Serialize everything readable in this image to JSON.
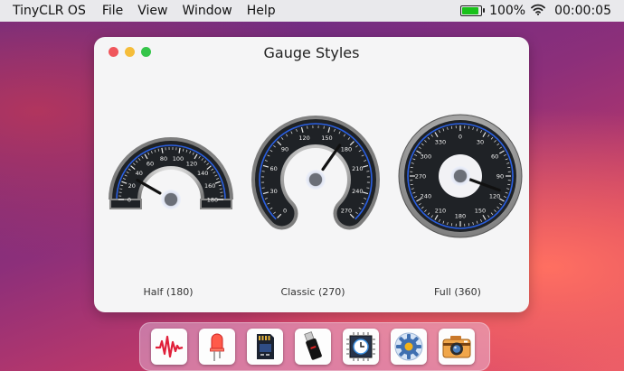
{
  "menubar": {
    "app_name": "TinyCLR OS",
    "menus": [
      "File",
      "View",
      "Window",
      "Help"
    ],
    "battery_percent": "100%",
    "battery_level": 1.0,
    "clock": "00:00:05",
    "colors": {
      "battery": "#19c11a"
    }
  },
  "window": {
    "title": "Gauge Styles"
  },
  "gauges": [
    {
      "label": "Half (180)",
      "style": "half",
      "ticks": [
        "0",
        "20",
        "40",
        "60",
        "80",
        "100",
        "120",
        "140",
        "160",
        "180"
      ],
      "value": 30
    },
    {
      "label": "Classic (270)",
      "style": "classic",
      "ticks": [
        "0",
        "30",
        "60",
        "90",
        "120",
        "150",
        "180",
        "210",
        "240",
        "270"
      ],
      "value": 170
    },
    {
      "label": "Full (360)",
      "style": "full",
      "ticks": [
        "0",
        "30",
        "60",
        "90",
        "120",
        "150",
        "180",
        "210",
        "240",
        "270",
        "300",
        "330"
      ],
      "value": 110
    }
  ],
  "dock": {
    "items": [
      {
        "icon": "waveform-icon"
      },
      {
        "icon": "led-icon"
      },
      {
        "icon": "sd-card-icon"
      },
      {
        "icon": "usb-drive-icon"
      },
      {
        "icon": "clock-chip-icon"
      },
      {
        "icon": "settings-gear-icon"
      },
      {
        "icon": "camera-icon"
      }
    ]
  }
}
